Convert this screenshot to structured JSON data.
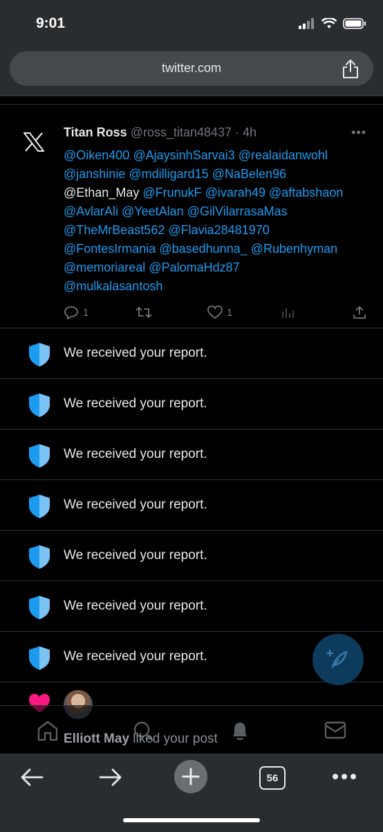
{
  "status_bar": {
    "time": "9:01"
  },
  "browser": {
    "url": "twitter.com",
    "tab_count": "56"
  },
  "tweet": {
    "name": "Titan Ross",
    "handle": "@ross_titan48437",
    "time": "· 4h",
    "more": "•••",
    "lines": [
      [
        {
          "text": "@Oiken400",
          "m": true
        },
        {
          "text": " ",
          "m": false
        },
        {
          "text": "@AjaysinhSarvai3",
          "m": true
        },
        {
          "text": " ",
          "m": false
        },
        {
          "text": "@realaidanwohl",
          "m": true
        }
      ],
      [
        {
          "text": "@janshinie",
          "m": true
        },
        {
          "text": " ",
          "m": false
        },
        {
          "text": "@mdilligard15",
          "m": true
        },
        {
          "text": " ",
          "m": false
        },
        {
          "text": "@NaBelen96",
          "m": true
        }
      ],
      [
        {
          "text": "@Ethan_May",
          "m": false
        },
        {
          "text": " ",
          "m": false
        },
        {
          "text": "@FrunukF",
          "m": true
        },
        {
          "text": " ",
          "m": false
        },
        {
          "text": "@ivarah49",
          "m": true
        },
        {
          "text": " ",
          "m": false
        },
        {
          "text": "@aftabshaon",
          "m": true
        }
      ],
      [
        {
          "text": "@AvlarAli",
          "m": true
        },
        {
          "text": " ",
          "m": false
        },
        {
          "text": "@YeetAlan",
          "m": true
        },
        {
          "text": " ",
          "m": false
        },
        {
          "text": "@GilVilarrasaMas",
          "m": true
        }
      ],
      [
        {
          "text": "@TheMrBeast562",
          "m": true
        },
        {
          "text": " ",
          "m": false
        },
        {
          "text": "@Flavia28481970",
          "m": true
        }
      ],
      [
        {
          "text": "@FontesIrmania",
          "m": true
        },
        {
          "text": " ",
          "m": false
        },
        {
          "text": "@basedhunna_",
          "m": true
        },
        {
          "text": " ",
          "m": false
        },
        {
          "text": "@Rubenhyman",
          "m": true
        }
      ],
      [
        {
          "text": "@memoriareal",
          "m": true
        },
        {
          "text": " ",
          "m": false
        },
        {
          "text": "@PalomaHdz87",
          "m": true
        }
      ],
      [
        {
          "text": "@mulkalasantosh",
          "m": true
        }
      ]
    ],
    "reply_count": "1",
    "like_count": "1"
  },
  "reports": [
    "We received your report.",
    "We received your report.",
    "We received your report.",
    "We received your report.",
    "We received your report.",
    "We received your report.",
    "We received your report."
  ],
  "notification": {
    "name": "Elliott May",
    "action": " liked your post"
  },
  "colors": {
    "mention": "#1d9bf0",
    "shield": "#1d9bf0",
    "heart": "#f91880",
    "fab": "#0d3b5c"
  }
}
